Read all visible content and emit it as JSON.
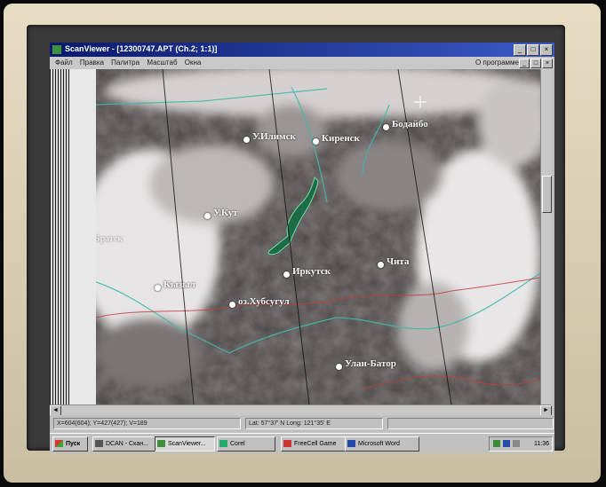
{
  "window": {
    "title": "ScanViewer - [12300747.APT (Ch.2; 1:1)]",
    "controls": [
      "_",
      "□",
      "×"
    ],
    "mdi_controls": [
      "_",
      "□",
      "×"
    ]
  },
  "menu": {
    "items": [
      "Файл",
      "Правка",
      "Палитра",
      "Масштаб",
      "Окна"
    ],
    "about": "О программе"
  },
  "map": {
    "cities": [
      {
        "name": "Ust-Ilimsk-label",
        "label": "У.Илимск"
      },
      {
        "name": "Kirensk-label",
        "label": "Киренск"
      },
      {
        "name": "Bodaibo-label",
        "label": "Бодайбо"
      },
      {
        "name": "Ust-Kut-label",
        "label": "У.Кут"
      },
      {
        "name": "Bratsk-label",
        "label": "Братск"
      },
      {
        "name": "Irkutsk-label",
        "label": "Иркутск"
      },
      {
        "name": "Chita-label",
        "label": "Чита"
      },
      {
        "name": "Khubsugul-label",
        "label": "оз.Хубсугул"
      },
      {
        "name": "Kyzyl-label",
        "label": "Кызыл"
      },
      {
        "name": "Ulaanbaatar-label",
        "label": "Улан-Батор"
      }
    ]
  },
  "status": {
    "pane1": "X=604(604); Y=427(427); V=189",
    "pane2": "Lat: 57°37' N    Long: 121°35' E"
  },
  "taskbar": {
    "start": "Пуск",
    "buttons": [
      "DCAN - Скан...",
      "ScanViewer...",
      "Corel",
      "FreeCell Game",
      "Microsoft Word"
    ],
    "clock": "11:36"
  },
  "colors": {
    "titlebar": "#0a1a6a",
    "border_lines": "#3fb8b0",
    "political_border": "#c83c3c",
    "baikal": "#1e6b4a"
  }
}
